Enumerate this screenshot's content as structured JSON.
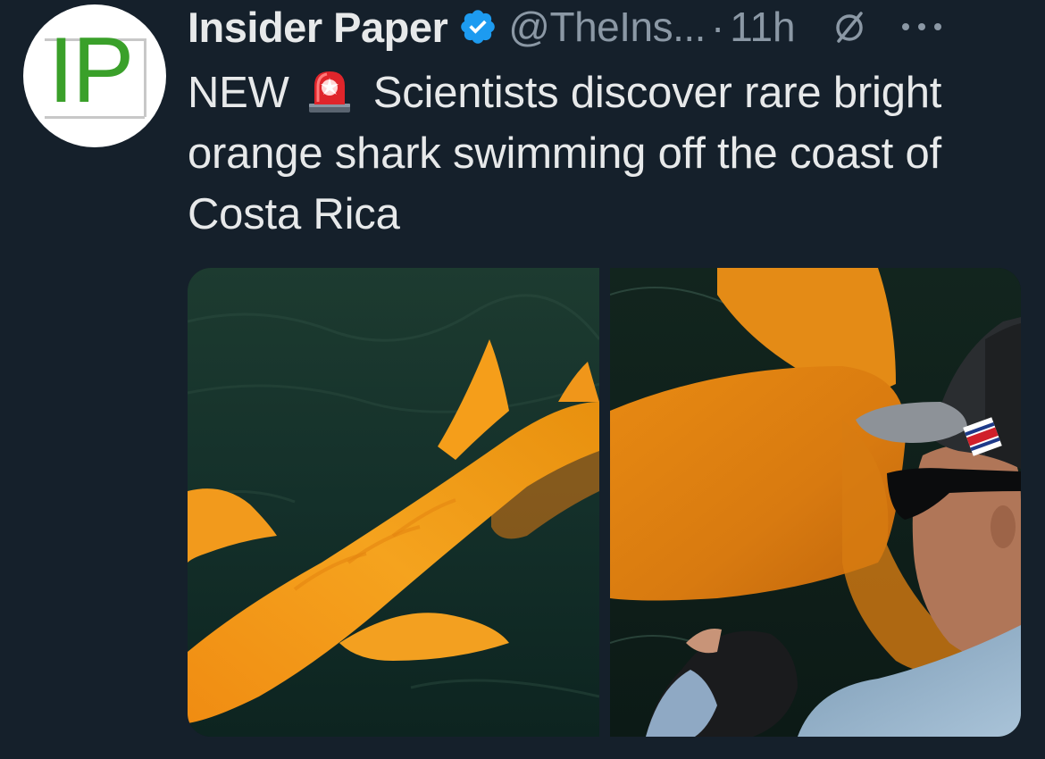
{
  "account": {
    "display_name": "Insider Paper",
    "handle": "@TheIns...",
    "separator": "·",
    "time": "11h",
    "verified": true,
    "avatar_text": "IP"
  },
  "tweet": {
    "prefix": "NEW",
    "emoji": "siren-emoji",
    "text": "Scientists discover rare bright orange shark swimming off the coast of Costa Rica"
  },
  "media": {
    "images": [
      {
        "name": "orange-shark-swimming-photo"
      },
      {
        "name": "orange-shark-held-by-man-photo"
      }
    ]
  },
  "colors": {
    "background": "#15202b",
    "text": "#e7e9ea",
    "muted": "#8b98a5",
    "verified": "#1d9bf0",
    "logo": "#3aa02a"
  },
  "icons": [
    "verified-badge-icon",
    "no-pin-icon",
    "more-options-icon",
    "siren-emoji"
  ]
}
